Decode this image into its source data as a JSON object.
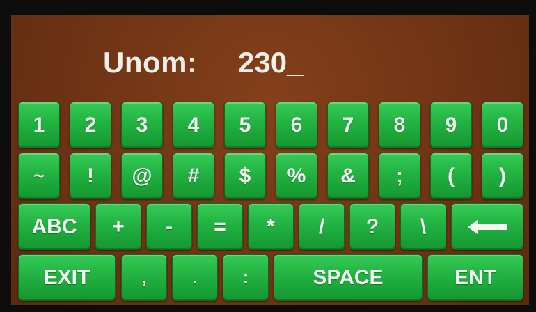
{
  "display": {
    "label": "Unom:",
    "value": "230_"
  },
  "keyboard": {
    "row1": [
      "1",
      "2",
      "3",
      "4",
      "5",
      "6",
      "7",
      "8",
      "9",
      "0"
    ],
    "row2": [
      "~",
      "!",
      "@",
      "#",
      "$",
      "%",
      "&",
      ";",
      "(",
      ")"
    ],
    "row3": [
      "ABC",
      "+",
      "-",
      "=",
      "*",
      "/",
      "?",
      "\\"
    ],
    "row4": [
      "EXIT",
      ",",
      ".",
      ":",
      "SPACE",
      "ENT"
    ],
    "backspace_icon": "left-arrow-icon"
  },
  "colors": {
    "key_green": "#22b242",
    "background_brown": "#6e3315",
    "text": "#f4f8f4"
  }
}
